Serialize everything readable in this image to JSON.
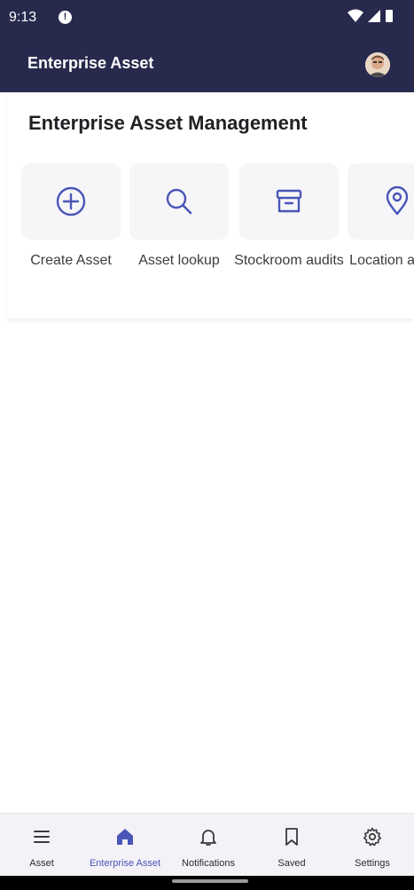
{
  "status_bar": {
    "time": "9:13",
    "info_icon": "info-icon",
    "icons": [
      "wifi-icon",
      "signal-icon",
      "battery-icon"
    ]
  },
  "app_bar": {
    "title": "Enterprise Asset",
    "avatar_icon": "user-avatar"
  },
  "main": {
    "title": "Enterprise Asset Management",
    "tiles": [
      {
        "label": "Create Asset",
        "icon": "plus-circle-icon"
      },
      {
        "label": "Asset lookup",
        "icon": "search-icon"
      },
      {
        "label": "Stockroom audits",
        "icon": "archive-box-icon"
      },
      {
        "label": "Location audits",
        "icon": "location-pin-icon"
      }
    ]
  },
  "bottom_nav": {
    "items": [
      {
        "label": "Asset",
        "icon": "menu-icon",
        "active": false
      },
      {
        "label": "Enterprise Asset",
        "icon": "home-icon",
        "active": true
      },
      {
        "label": "Notifications",
        "icon": "bell-icon",
        "active": false
      },
      {
        "label": "Saved",
        "icon": "bookmark-icon",
        "active": false
      },
      {
        "label": "Settings",
        "icon": "gear-icon",
        "active": false
      }
    ]
  },
  "colors": {
    "header": "#272a4d",
    "accent": "#4a55b8",
    "tile_bg": "#f6f6f8",
    "nav_bg": "#f4f1f7"
  }
}
